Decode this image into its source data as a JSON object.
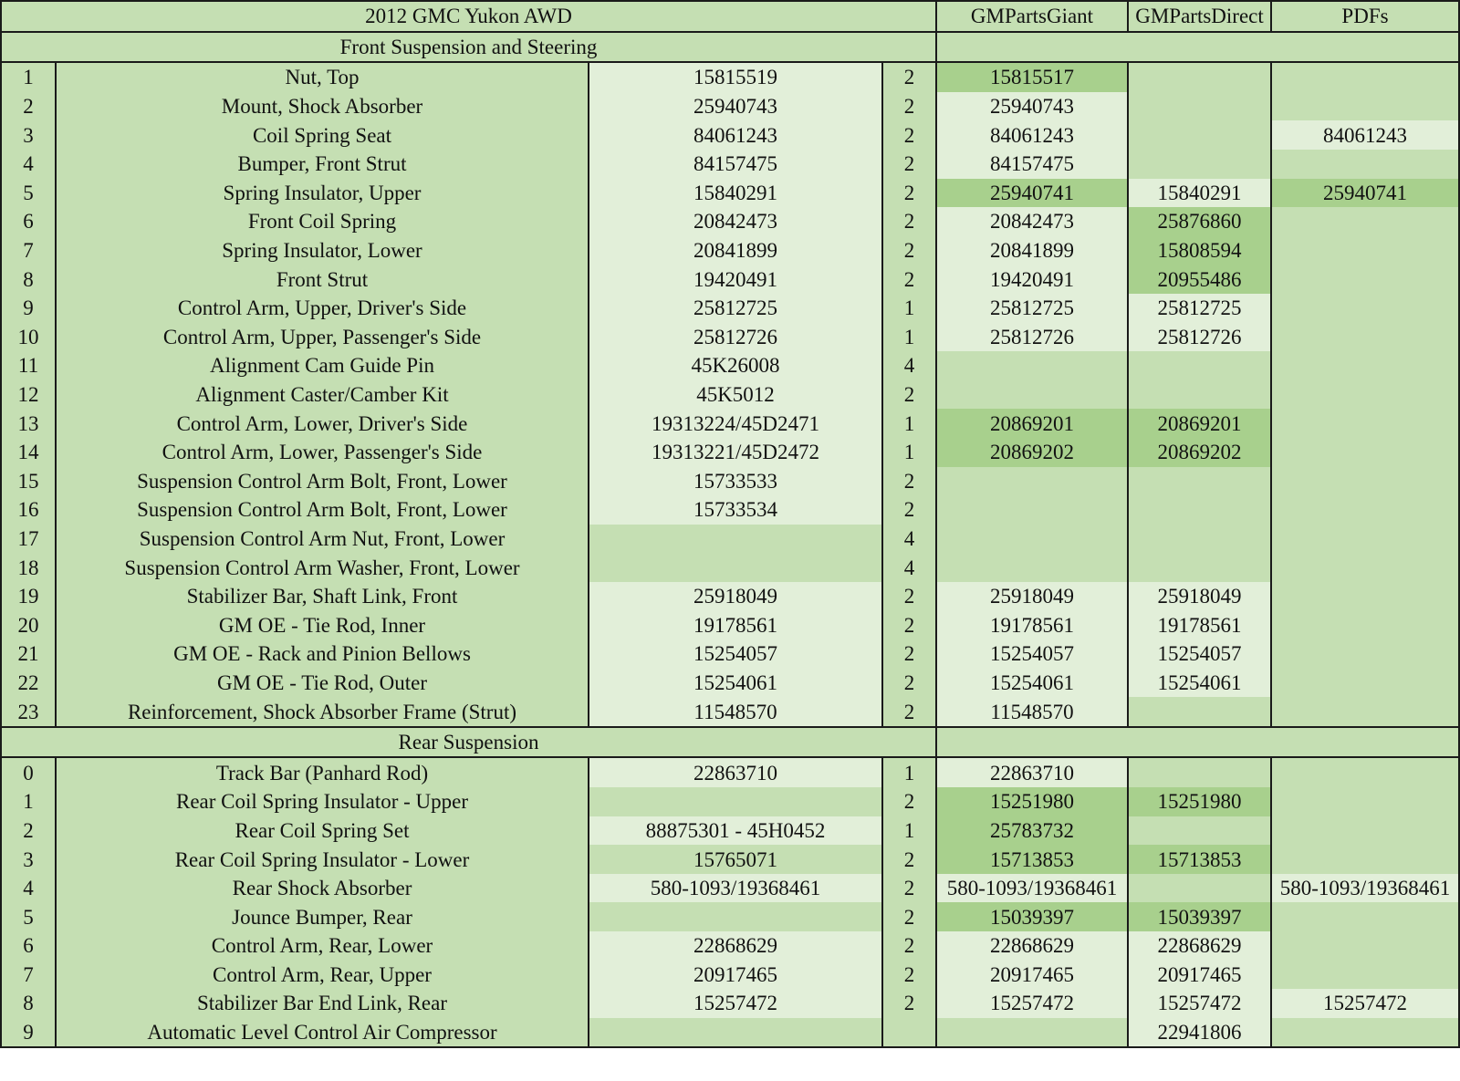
{
  "header": {
    "title": "2012 GMC Yukon AWD",
    "col_giant": "GMPartsGiant",
    "col_direct": "GMPartsDirect",
    "col_pdfs": "PDFs"
  },
  "sections": [
    {
      "title": "Front Suspension and Steering",
      "rows": [
        {
          "n": "1",
          "name": "Nut, Top",
          "pn": "15815519",
          "qty": "2",
          "giant": "15815517",
          "direct": "",
          "pdf": "",
          "cp": "l",
          "cg": "d",
          "cd": "m",
          "cf": "m"
        },
        {
          "n": "2",
          "name": "Mount, Shock Absorber",
          "pn": "25940743",
          "qty": "2",
          "giant": "25940743",
          "direct": "",
          "pdf": "",
          "cp": "l",
          "cg": "l",
          "cd": "m",
          "cf": "m"
        },
        {
          "n": "3",
          "name": "Coil Spring Seat",
          "pn": "84061243",
          "qty": "2",
          "giant": "84061243",
          "direct": "",
          "pdf": "84061243",
          "cp": "l",
          "cg": "l",
          "cd": "m",
          "cf": "l"
        },
        {
          "n": "4",
          "name": "Bumper, Front Strut",
          "pn": "84157475",
          "qty": "2",
          "giant": "84157475",
          "direct": "",
          "pdf": "",
          "cp": "l",
          "cg": "l",
          "cd": "m",
          "cf": "m"
        },
        {
          "n": "5",
          "name": "Spring Insulator, Upper",
          "pn": "15840291",
          "qty": "2",
          "giant": "25940741",
          "direct": "15840291",
          "pdf": "25940741",
          "cp": "l",
          "cg": "d",
          "cd": "l",
          "cf": "d"
        },
        {
          "n": "6",
          "name": "Front Coil Spring",
          "pn": "20842473",
          "qty": "2",
          "giant": "20842473",
          "direct": "25876860",
          "pdf": "",
          "cp": "l",
          "cg": "l",
          "cd": "d",
          "cf": "m"
        },
        {
          "n": "7",
          "name": "Spring Insulator, Lower",
          "pn": "20841899",
          "qty": "2",
          "giant": "20841899",
          "direct": "15808594",
          "pdf": "",
          "cp": "l",
          "cg": "l",
          "cd": "d",
          "cf": "m"
        },
        {
          "n": "8",
          "name": "Front Strut",
          "pn": "19420491",
          "qty": "2",
          "giant": "19420491",
          "direct": "20955486",
          "pdf": "",
          "cp": "l",
          "cg": "l",
          "cd": "d",
          "cf": "m"
        },
        {
          "n": "9",
          "name": "Control Arm, Upper, Driver's Side",
          "pn": "25812725",
          "qty": "1",
          "giant": "25812725",
          "direct": "25812725",
          "pdf": "",
          "cp": "l",
          "cg": "l",
          "cd": "l",
          "cf": "m"
        },
        {
          "n": "10",
          "name": "Control Arm, Upper, Passenger's Side",
          "pn": "25812726",
          "qty": "1",
          "giant": "25812726",
          "direct": "25812726",
          "pdf": "",
          "cp": "l",
          "cg": "l",
          "cd": "l",
          "cf": "m"
        },
        {
          "n": "11",
          "name": "Alignment Cam Guide Pin",
          "pn": "45K26008",
          "qty": "4",
          "giant": "",
          "direct": "",
          "pdf": "",
          "cp": "l",
          "cg": "m",
          "cd": "m",
          "cf": "m"
        },
        {
          "n": "12",
          "name": "Alignment Caster/Camber Kit",
          "pn": "45K5012",
          "qty": "2",
          "giant": "",
          "direct": "",
          "pdf": "",
          "cp": "l",
          "cg": "m",
          "cd": "m",
          "cf": "m"
        },
        {
          "n": "13",
          "name": "Control Arm, Lower, Driver's Side",
          "pn": "19313224/45D2471",
          "qty": "1",
          "giant": "20869201",
          "direct": "20869201",
          "pdf": "",
          "cp": "l",
          "cg": "d",
          "cd": "d",
          "cf": "m"
        },
        {
          "n": "14",
          "name": "Control Arm, Lower, Passenger's Side",
          "pn": "19313221/45D2472",
          "qty": "1",
          "giant": "20869202",
          "direct": "20869202",
          "pdf": "",
          "cp": "l",
          "cg": "d",
          "cd": "d",
          "cf": "m"
        },
        {
          "n": "15",
          "name": "Suspension Control Arm Bolt, Front, Lower",
          "pn": "15733533",
          "qty": "2",
          "giant": "",
          "direct": "",
          "pdf": "",
          "cp": "l",
          "cg": "m",
          "cd": "m",
          "cf": "m"
        },
        {
          "n": "16",
          "name": "Suspension Control Arm Bolt, Front, Lower",
          "pn": "15733534",
          "qty": "2",
          "giant": "",
          "direct": "",
          "pdf": "",
          "cp": "l",
          "cg": "m",
          "cd": "m",
          "cf": "m"
        },
        {
          "n": "17",
          "name": "Suspension Control Arm Nut, Front, Lower",
          "pn": "",
          "qty": "4",
          "giant": "",
          "direct": "",
          "pdf": "",
          "cp": "m",
          "cg": "m",
          "cd": "m",
          "cf": "m"
        },
        {
          "n": "18",
          "name": "Suspension Control Arm Washer, Front, Lower",
          "pn": "",
          "qty": "4",
          "giant": "",
          "direct": "",
          "pdf": "",
          "cp": "m",
          "cg": "m",
          "cd": "m",
          "cf": "m"
        },
        {
          "n": "19",
          "name": "Stabilizer Bar, Shaft Link, Front",
          "pn": "25918049",
          "qty": "2",
          "giant": "25918049",
          "direct": "25918049",
          "pdf": "",
          "cp": "l",
          "cg": "l",
          "cd": "l",
          "cf": "m"
        },
        {
          "n": "20",
          "name": "GM OE - Tie Rod, Inner",
          "pn": "19178561",
          "qty": "2",
          "giant": "19178561",
          "direct": "19178561",
          "pdf": "",
          "cp": "l",
          "cg": "l",
          "cd": "l",
          "cf": "m"
        },
        {
          "n": "21",
          "name": "GM OE - Rack and Pinion Bellows",
          "pn": "15254057",
          "qty": "2",
          "giant": "15254057",
          "direct": "15254057",
          "pdf": "",
          "cp": "l",
          "cg": "l",
          "cd": "l",
          "cf": "m"
        },
        {
          "n": "22",
          "name": "GM OE - Tie Rod, Outer",
          "pn": "15254061",
          "qty": "2",
          "giant": "15254061",
          "direct": "15254061",
          "pdf": "",
          "cp": "l",
          "cg": "l",
          "cd": "l",
          "cf": "m"
        },
        {
          "n": "23",
          "name": "Reinforcement, Shock Absorber Frame (Strut)",
          "pn": "11548570",
          "qty": "2",
          "giant": "11548570",
          "direct": "",
          "pdf": "",
          "cp": "l",
          "cg": "l",
          "cd": "m",
          "cf": "m"
        }
      ]
    },
    {
      "title": "Rear Suspension",
      "rows": [
        {
          "n": "0",
          "name": "Track Bar (Panhard Rod)",
          "pn": "22863710",
          "qty": "1",
          "giant": "22863710",
          "direct": "",
          "pdf": "",
          "cp": "l",
          "cg": "l",
          "cd": "m",
          "cf": "m"
        },
        {
          "n": "1",
          "name": "Rear Coil Spring Insulator - Upper",
          "pn": "",
          "qty": "2",
          "giant": "15251980",
          "direct": "15251980",
          "pdf": "",
          "cp": "m",
          "cg": "d",
          "cd": "d",
          "cf": "m"
        },
        {
          "n": "2",
          "name": "Rear Coil Spring Set",
          "pn": "88875301 - 45H0452",
          "qty": "1",
          "giant": "25783732",
          "direct": "",
          "pdf": "",
          "cp": "l",
          "cg": "d",
          "cd": "m",
          "cf": "m"
        },
        {
          "n": "3",
          "name": "Rear Coil Spring Insulator - Lower",
          "pn": "15765071",
          "qty": "2",
          "giant": "15713853",
          "direct": "15713853",
          "pdf": "",
          "cp": "m",
          "cg": "d",
          "cd": "d",
          "cf": "m"
        },
        {
          "n": "4",
          "name": "Rear Shock Absorber",
          "pn": "580-1093/19368461",
          "qty": "2",
          "giant": "580-1093/19368461",
          "direct": "",
          "pdf": "580-1093/19368461",
          "cp": "l",
          "cg": "l",
          "cd": "m",
          "cf": "l"
        },
        {
          "n": "5",
          "name": "Jounce Bumper, Rear",
          "pn": "",
          "qty": "2",
          "giant": "15039397",
          "direct": "15039397",
          "pdf": "",
          "cp": "m",
          "cg": "d",
          "cd": "d",
          "cf": "m"
        },
        {
          "n": "6",
          "name": "Control Arm, Rear, Lower",
          "pn": "22868629",
          "qty": "2",
          "giant": "22868629",
          "direct": "22868629",
          "pdf": "",
          "cp": "l",
          "cg": "l",
          "cd": "l",
          "cf": "m"
        },
        {
          "n": "7",
          "name": "Control Arm, Rear, Upper",
          "pn": "20917465",
          "qty": "2",
          "giant": "20917465",
          "direct": "20917465",
          "pdf": "",
          "cp": "l",
          "cg": "l",
          "cd": "l",
          "cf": "m"
        },
        {
          "n": "8",
          "name": "Stabilizer Bar End Link, Rear",
          "pn": "15257472",
          "qty": "2",
          "giant": "15257472",
          "direct": "15257472",
          "pdf": "15257472",
          "cp": "l",
          "cg": "l",
          "cd": "l",
          "cf": "l"
        },
        {
          "n": "9",
          "name": "Automatic Level Control Air Compressor",
          "pn": "",
          "qty": "",
          "giant": "",
          "direct": "22941806",
          "pdf": "",
          "cp": "m",
          "cg": "m",
          "cd": "l",
          "cf": "m"
        }
      ]
    }
  ]
}
